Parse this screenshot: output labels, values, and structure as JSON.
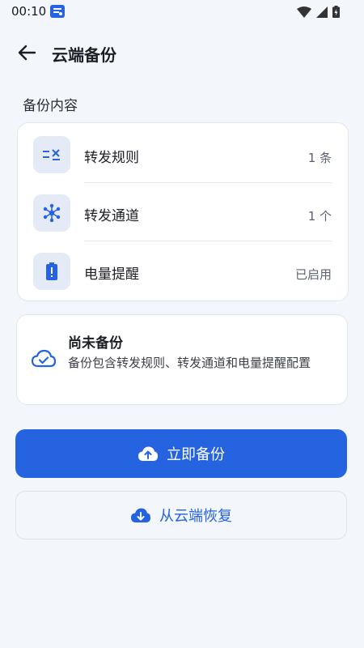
{
  "status_bar": {
    "time": "00:10",
    "icons": [
      "notification-app-icon",
      "wifi-icon",
      "signal-icon",
      "battery-icon"
    ]
  },
  "app_bar": {
    "back_icon": "back-arrow-icon",
    "title": "云端备份"
  },
  "backup_content": {
    "section_label": "备份内容",
    "items": [
      {
        "icon": "forward-rules-icon",
        "label": "转发规则",
        "value": "1 条"
      },
      {
        "icon": "network-hub-icon",
        "label": "转发通道",
        "value": "1 个"
      },
      {
        "icon": "battery-alert-icon",
        "label": "电量提醒",
        "value": "已启用"
      }
    ]
  },
  "backup_status": {
    "icon": "cloud-check-icon",
    "title": "尚未备份",
    "description": "备份包含转发规则、转发通道和电量提醒配置"
  },
  "actions": {
    "backup_now": {
      "icon": "cloud-upload-icon",
      "label": "立即备份"
    },
    "restore": {
      "icon": "cloud-download-icon",
      "label": "从云端恢复"
    }
  },
  "colors": {
    "primary": "#2563e0",
    "background": "#f3f6fb",
    "icon_box": "#e4ebf7",
    "card": "#ffffff"
  }
}
